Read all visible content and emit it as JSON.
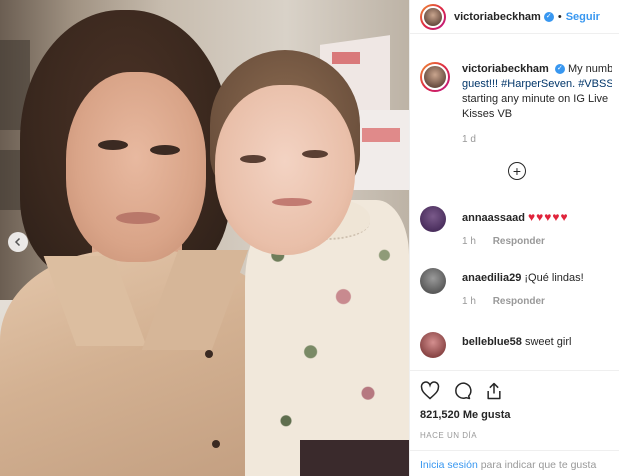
{
  "header": {
    "username": "victoriabeckham",
    "separator": "•",
    "follow_label": "Seguir"
  },
  "caption": {
    "username": "victoriabeckham",
    "text_start": "My numb",
    "text_line2_tag1": "guest!!! #HarperSeven.",
    "text_line2_tag2": "#VBSS",
    "text_line3": "starting any minute on IG Live",
    "text_line4": "Kisses VB",
    "time": "1 d"
  },
  "comments": [
    {
      "username": "annaassaad",
      "text": "♥♥♥♥♥",
      "time": "1 h",
      "reply_label": "Responder",
      "avatar_color": "#4b2f5e"
    },
    {
      "username": "anaedilia29",
      "text": "¡Qué lindas!",
      "time": "1 h",
      "reply_label": "Responder",
      "avatar_color": "#c8c8c8"
    },
    {
      "username": "belleblue58",
      "text": "sweet girl",
      "time": "",
      "reply_label": "",
      "avatar_color": "#b56a6a"
    }
  ],
  "actions": {
    "likes": "821,520 Me gusta",
    "posted_ago": "HACE UN DÍA"
  },
  "login": {
    "link": "Inicia sesión",
    "text": "para indicar que te gusta"
  },
  "colors": {
    "link_blue": "#3897f0",
    "hashtag": "#003569",
    "heart_red": "#e0243b"
  }
}
